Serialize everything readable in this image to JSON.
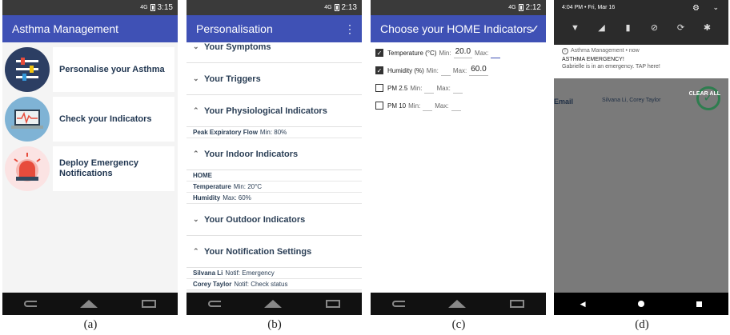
{
  "panel_a": {
    "status_time": "3:15",
    "status_net": "4G",
    "title": "Asthma Management",
    "items": [
      {
        "label": "Personalise your Asthma",
        "icon": "sliders-icon"
      },
      {
        "label": "Check your Indicators",
        "icon": "laptop-heartbeat-icon"
      },
      {
        "label": "Deploy Emergency Notifications",
        "icon": "siren-icon"
      }
    ],
    "caption": "(a)"
  },
  "panel_b": {
    "status_time": "2:13",
    "status_net": "4G",
    "title": "Personalisation",
    "sections": [
      {
        "title": "Your Symptoms",
        "expanded": false,
        "rows": []
      },
      {
        "title": "Your Triggers",
        "expanded": false,
        "rows": []
      },
      {
        "title": "Your Physiological Indicators",
        "expanded": true,
        "rows": [
          {
            "key": "Peak Expiratory Flow",
            "val": "Min: 80%"
          }
        ]
      },
      {
        "title": "Your Indoor Indicators",
        "expanded": true,
        "rows": [
          {
            "key": "HOME",
            "val": ""
          },
          {
            "key": "Temperature",
            "val": "Min: 20°C"
          },
          {
            "key": "Humidity",
            "val": "Max: 60%"
          }
        ]
      },
      {
        "title": "Your Outdoor Indicators",
        "expanded": false,
        "rows": []
      },
      {
        "title": "Your Notification Settings",
        "expanded": true,
        "rows": [
          {
            "key": "Silvana Li",
            "val": "Notif: Emergency"
          },
          {
            "key": "Corey Taylor",
            "val": "Notif: Check status"
          }
        ]
      }
    ],
    "caption": "(b)"
  },
  "panel_c": {
    "status_time": "2:12",
    "status_net": "4G",
    "title": "Choose your HOME Indicators",
    "indicators": [
      {
        "name": "Temperature (°C)",
        "checked": true,
        "min": "20.0",
        "max": "",
        "min_label": "Min:",
        "max_label": "Max:"
      },
      {
        "name": "Humidity (%)",
        "checked": true,
        "min": "",
        "max": "60.0",
        "min_label": "Min:",
        "max_label": "Max:"
      },
      {
        "name": "PM 2.5",
        "checked": false,
        "min": "",
        "max": "",
        "min_label": "Min:",
        "max_label": "Max:"
      },
      {
        "name": "PM 10",
        "checked": false,
        "min": "",
        "max": "",
        "min_label": "Min:",
        "max_label": "Max:"
      }
    ],
    "caption": "(c)"
  },
  "panel_d": {
    "time_date": "4:04 PM • Fri, Mar 16",
    "notif_app": "Asthma Management • now",
    "notif_title": "ASTHMA EMERGENCY!",
    "notif_body": "Gabrielle is in an emergency. TAP here!",
    "bg_email": "Email",
    "bg_names": "Silvana Li, Corey Taylor",
    "clear_all": "CLEAR ALL",
    "caption": "(d)"
  }
}
